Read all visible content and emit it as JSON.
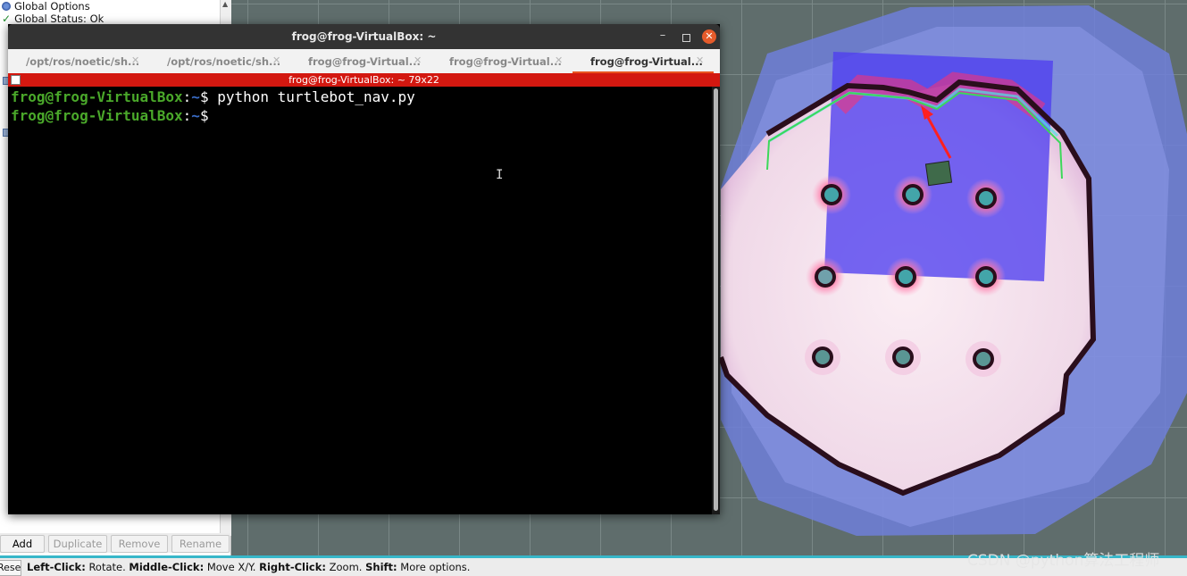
{
  "rviz": {
    "displays": {
      "global_options": "Global Options",
      "global_status": "Global Status: Ok"
    },
    "buttons": {
      "add": "Add",
      "duplicate": "Duplicate",
      "remove": "Remove",
      "rename": "Rename"
    },
    "status_bar": {
      "reset": "Reset",
      "left_click_key": "Left-Click:",
      "left_click_action": "Rotate.",
      "middle_click_key": "Middle-Click:",
      "middle_click_action": "Move X/Y.",
      "right_click_key": "Right-Click:",
      "right_click_action": "Zoom.",
      "shift_key": "Shift:",
      "shift_action": "More options."
    }
  },
  "terminal": {
    "window_title": "frog@frog-VirtualBox: ~",
    "tabs": [
      {
        "label": "/opt/ros/noetic/sh...",
        "active": false
      },
      {
        "label": "/opt/ros/noetic/sh...",
        "active": false
      },
      {
        "label": "frog@frog-Virtual...",
        "active": false
      },
      {
        "label": "frog@frog-Virtual...",
        "active": false
      },
      {
        "label": "frog@frog-Virtual...",
        "active": true
      }
    ],
    "header": "frog@frog-VirtualBox: ~ 79x22",
    "lines": [
      {
        "user": "frog@frog-VirtualBox",
        "sep": ":",
        "path": "~",
        "symbol": "$ ",
        "command": "python turtlebot_nav.py"
      },
      {
        "user": "frog@frog-VirtualBox",
        "sep": ":",
        "path": "~",
        "symbol": "$ ",
        "command": ""
      }
    ]
  },
  "watermark": "CSDN @python算法工程师",
  "colors": {
    "grid_background": "#5f6d6c",
    "costmap_inner": "#f4e6ee",
    "costmap_outer": "#6e7fd9",
    "obstacle": "#2a0e1c",
    "terminal_header": "#d31810",
    "status_bar_accent": "#37b7c9",
    "prompt_user": "#4aa82a",
    "prompt_path": "#3a6dc8"
  }
}
